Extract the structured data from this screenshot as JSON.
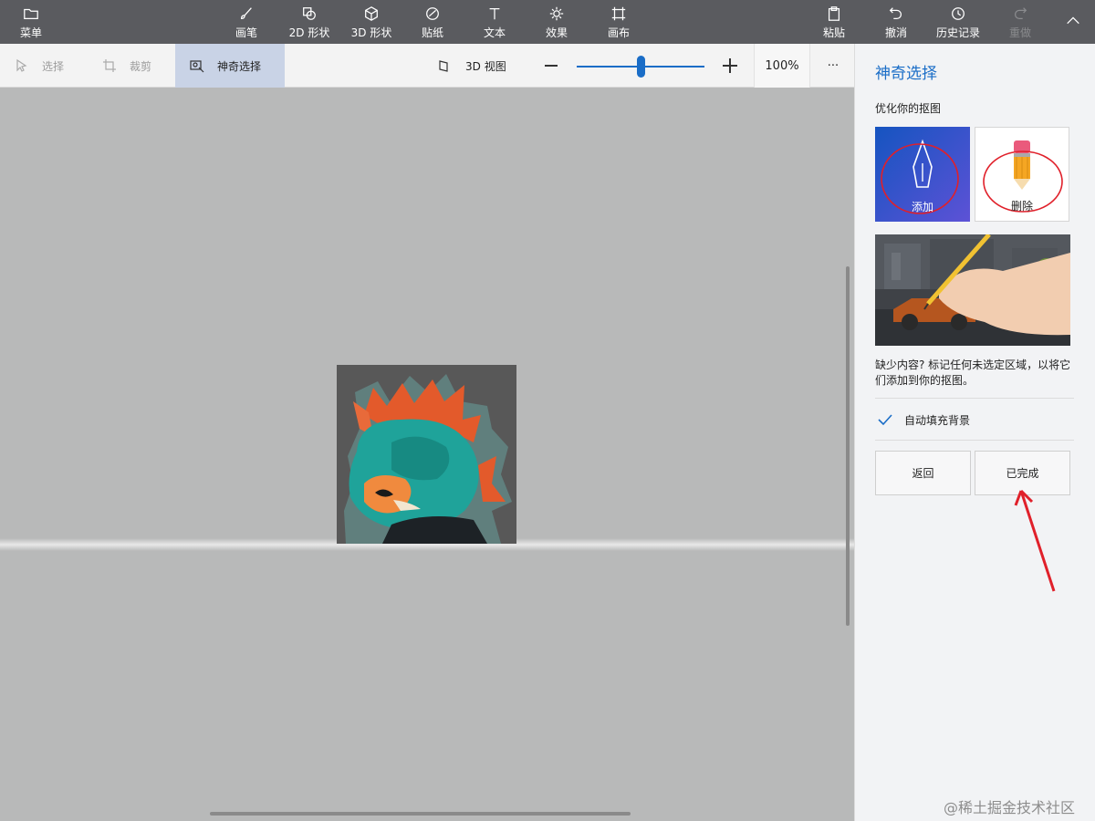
{
  "ribbon": {
    "menu": "菜单",
    "tools": [
      {
        "label": "画笔",
        "icon": "brush-icon"
      },
      {
        "label": "2D 形状",
        "icon": "shapes-2d-icon"
      },
      {
        "label": "3D 形状",
        "icon": "cube-icon"
      },
      {
        "label": "贴纸",
        "icon": "sticker-icon"
      },
      {
        "label": "文本",
        "icon": "text-icon"
      },
      {
        "label": "效果",
        "icon": "sun-icon"
      },
      {
        "label": "画布",
        "icon": "canvas-icon"
      }
    ],
    "paste": "粘贴",
    "undo": "撤消",
    "history": "历史记录",
    "redo": "重做"
  },
  "toolbar": {
    "select": "选择",
    "crop": "裁剪",
    "magic_select": "神奇选择",
    "view_3d": "3D 视图",
    "zoom_percent": 100,
    "zoom_label": "100%",
    "more": "···"
  },
  "panel": {
    "title": "神奇选择",
    "subtitle": "优化你的抠图",
    "add_label": "添加",
    "remove_label": "删除",
    "help_text": "缺少内容? 标记任何未选定区域，以将它们添加到你的抠图。",
    "autofill_label": "自动填充背景",
    "autofill_checked": true,
    "back_label": "返回",
    "done_label": "已完成"
  },
  "colors": {
    "accent": "#1a6dc7",
    "ribbon_bg": "#5a5b5f",
    "annotation_red": "#e0202a"
  },
  "watermark": "@稀土掘金技术社区"
}
